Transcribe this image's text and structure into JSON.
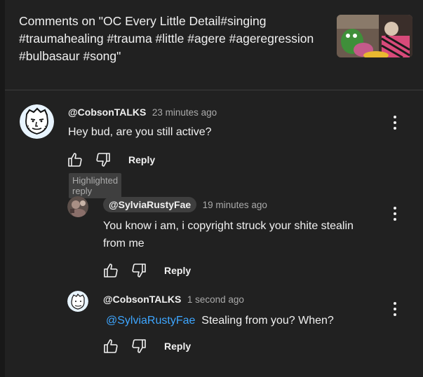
{
  "header": {
    "title": "Comments on \"OC Every Little Detail#singing #traumahealing #trauma #little #agere #ageregression #bulbasaur #song\""
  },
  "comments": [
    {
      "author": "@CobsonTALKS",
      "time": "23 minutes ago",
      "text": "Hey bud, are you still active?",
      "reply_label": "Reply",
      "badge": "Highlighted reply"
    },
    {
      "author": "@SylviaRustyFae",
      "time": "19 minutes ago",
      "text": "You know i am, i copyright struck your shite stealin from me",
      "reply_label": "Reply"
    },
    {
      "author": "@CobsonTALKS",
      "time": "1 second ago",
      "mention": "@SylviaRustyFae",
      "text": "Stealing from you? When?",
      "reply_label": "Reply"
    }
  ],
  "icons": {
    "like": "thumbs-up-icon",
    "dislike": "thumbs-down-icon",
    "more": "more-vert-icon"
  },
  "colors": {
    "background": "#212121",
    "mention": "#3ea6ff",
    "secondary_text": "#aaaaaa"
  }
}
